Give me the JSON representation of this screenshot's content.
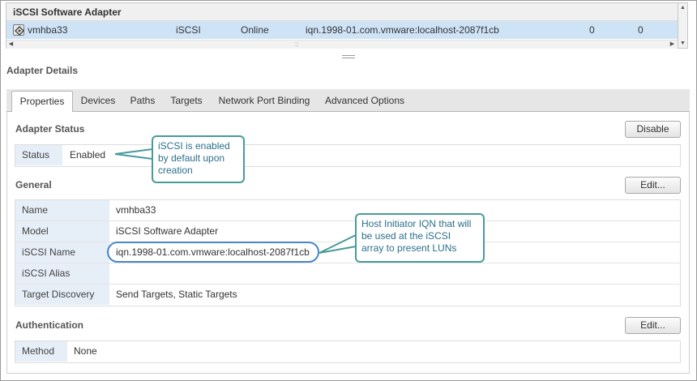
{
  "adapter_list": {
    "header": "iSCSI Software Adapter",
    "row": {
      "name": "vmhba33",
      "type": "iSCSI",
      "status": "Online",
      "identifier": "iqn.1998-01.com.vmware:localhost-2087f1cb",
      "targets": "0",
      "devices": "0"
    },
    "icon": "adapter-icon",
    "scroll_grip": "::",
    "arrow_left": "◀",
    "arrow_right": "▶",
    "arrow_up": "▲",
    "arrow_down": "▼"
  },
  "details": {
    "title": "Adapter Details",
    "tabs": [
      "Properties",
      "Devices",
      "Paths",
      "Targets",
      "Network Port Binding",
      "Advanced Options"
    ],
    "active_tab": "Properties"
  },
  "adapter_status": {
    "title": "Adapter Status",
    "button": "Disable",
    "rows": [
      {
        "label": "Status",
        "value": "Enabled"
      }
    ]
  },
  "general": {
    "title": "General",
    "button": "Edit...",
    "rows": [
      {
        "label": "Name",
        "value": "vmhba33"
      },
      {
        "label": "Model",
        "value": "iSCSI Software Adapter"
      },
      {
        "label": "iSCSI Name",
        "value": "iqn.1998-01.com.vmware:localhost-2087f1cb"
      },
      {
        "label": "iSCSI Alias",
        "value": ""
      },
      {
        "label": "Target Discovery",
        "value": "Send Targets, Static Targets"
      }
    ]
  },
  "authentication": {
    "title": "Authentication",
    "button": "Edit...",
    "rows": [
      {
        "label": "Method",
        "value": "None"
      }
    ]
  },
  "callouts": {
    "status_note": [
      "iSCSI is enabled",
      "by default upon",
      "creation"
    ],
    "iqn_note": [
      "Host Initiator IQN that will",
      "be used at the iSCSI",
      "array to present LUNs"
    ]
  },
  "colors": {
    "selected_row": "#cfe3f7",
    "label_bg": "#e6eef7",
    "callout_border": "#4a9a9a",
    "callout_text": "#2b6f8c",
    "oval": "#4a86c8"
  }
}
